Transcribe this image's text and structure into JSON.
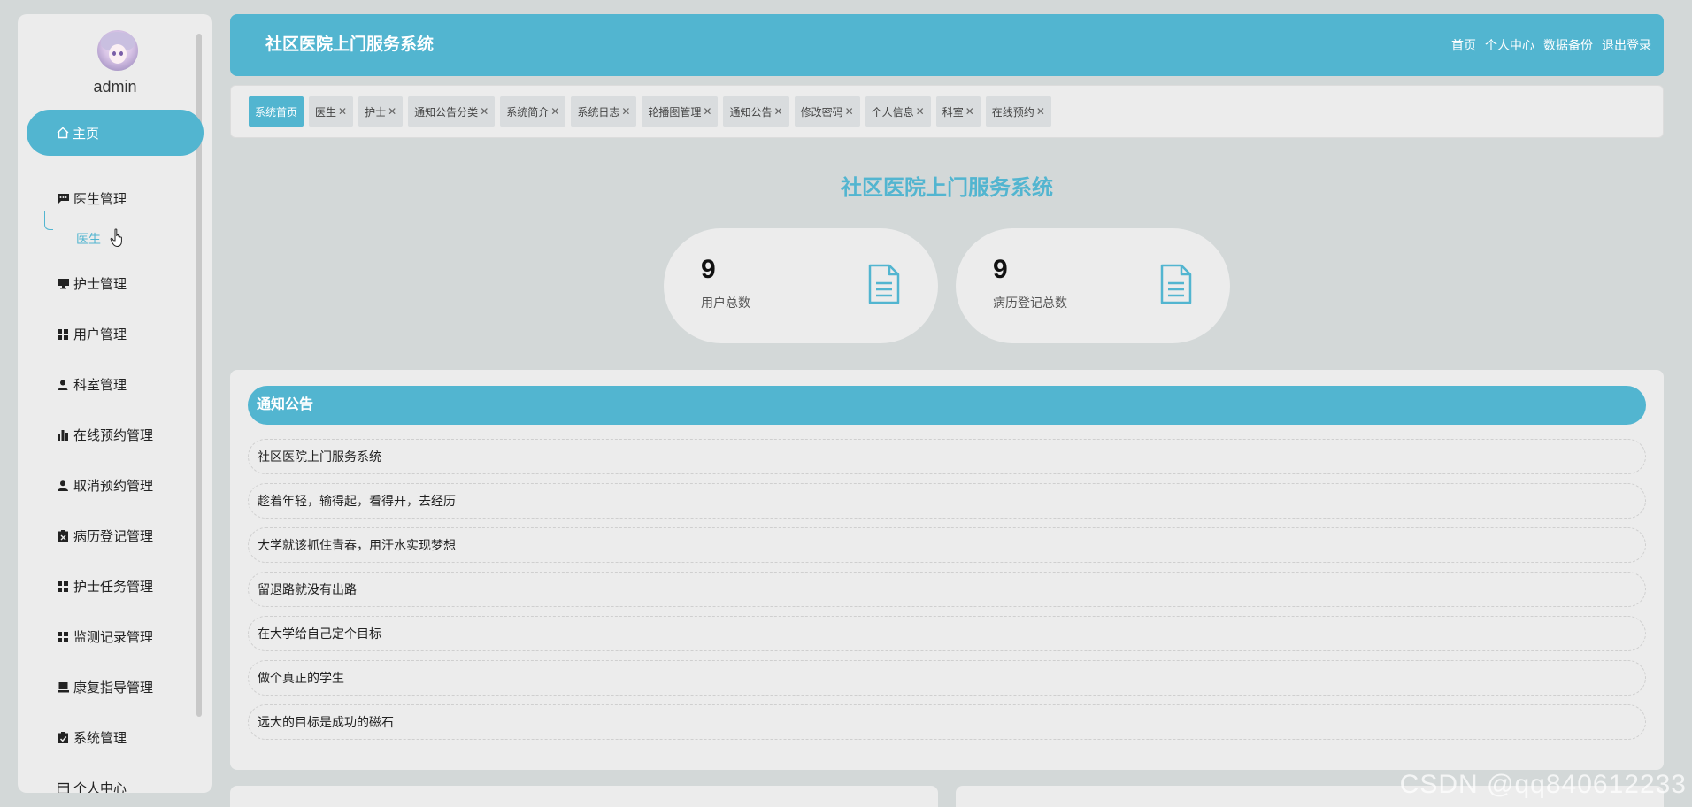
{
  "sidebar": {
    "username": "admin",
    "home_label": "主页",
    "items": [
      {
        "label": "医生管理",
        "icon": "chat-icon"
      },
      {
        "label": "护士管理",
        "icon": "monitor-icon"
      },
      {
        "label": "用户管理",
        "icon": "grid-icon"
      },
      {
        "label": "科室管理",
        "icon": "user-icon"
      },
      {
        "label": "在线预约管理",
        "icon": "bar-chart-icon"
      },
      {
        "label": "取消预约管理",
        "icon": "person-icon"
      },
      {
        "label": "病历登记管理",
        "icon": "clipboard-x-icon"
      },
      {
        "label": "护士任务管理",
        "icon": "grid-icon"
      },
      {
        "label": "监测记录管理",
        "icon": "grid-icon"
      },
      {
        "label": "康复指导管理",
        "icon": "laptop-icon"
      },
      {
        "label": "系统管理",
        "icon": "clipboard-check-icon"
      },
      {
        "label": "个人中心",
        "icon": "calendar-icon"
      }
    ],
    "sub_item": "医生"
  },
  "header": {
    "title": "社区医院上门服务系统",
    "nav": [
      "首页",
      "个人中心",
      "数据备份",
      "退出登录"
    ]
  },
  "tabs": [
    {
      "label": "系统首页",
      "active": true
    },
    {
      "label": "医生",
      "closable": true
    },
    {
      "label": "护士",
      "closable": true
    },
    {
      "label": "通知公告分类",
      "closable": true
    },
    {
      "label": "系统简介",
      "closable": true
    },
    {
      "label": "系统日志",
      "closable": true
    },
    {
      "label": "轮播图管理",
      "closable": true
    },
    {
      "label": "通知公告",
      "closable": true
    },
    {
      "label": "修改密码",
      "closable": true
    },
    {
      "label": "个人信息",
      "closable": true
    },
    {
      "label": "科室",
      "closable": true
    },
    {
      "label": "在线预约",
      "closable": true
    }
  ],
  "main": {
    "welcome_title": "社区医院上门服务系统",
    "stats": [
      {
        "value": "9",
        "label": "用户总数"
      },
      {
        "value": "9",
        "label": "病历登记总数"
      }
    ]
  },
  "notice": {
    "title": "通知公告",
    "items": [
      "社区医院上门服务系统",
      "趁着年轻，输得起，看得开，去经历",
      "大学就该抓住青春，用汗水实现梦想",
      "留退路就没有出路",
      "在大学给自己定个目标",
      "做个真正的学生",
      "远大的目标是成功的磁石"
    ]
  },
  "watermark": "CSDN @qq840612233",
  "colors": {
    "accent": "#52b5d0",
    "background": "#d3d8d8",
    "panel": "#ececec"
  }
}
